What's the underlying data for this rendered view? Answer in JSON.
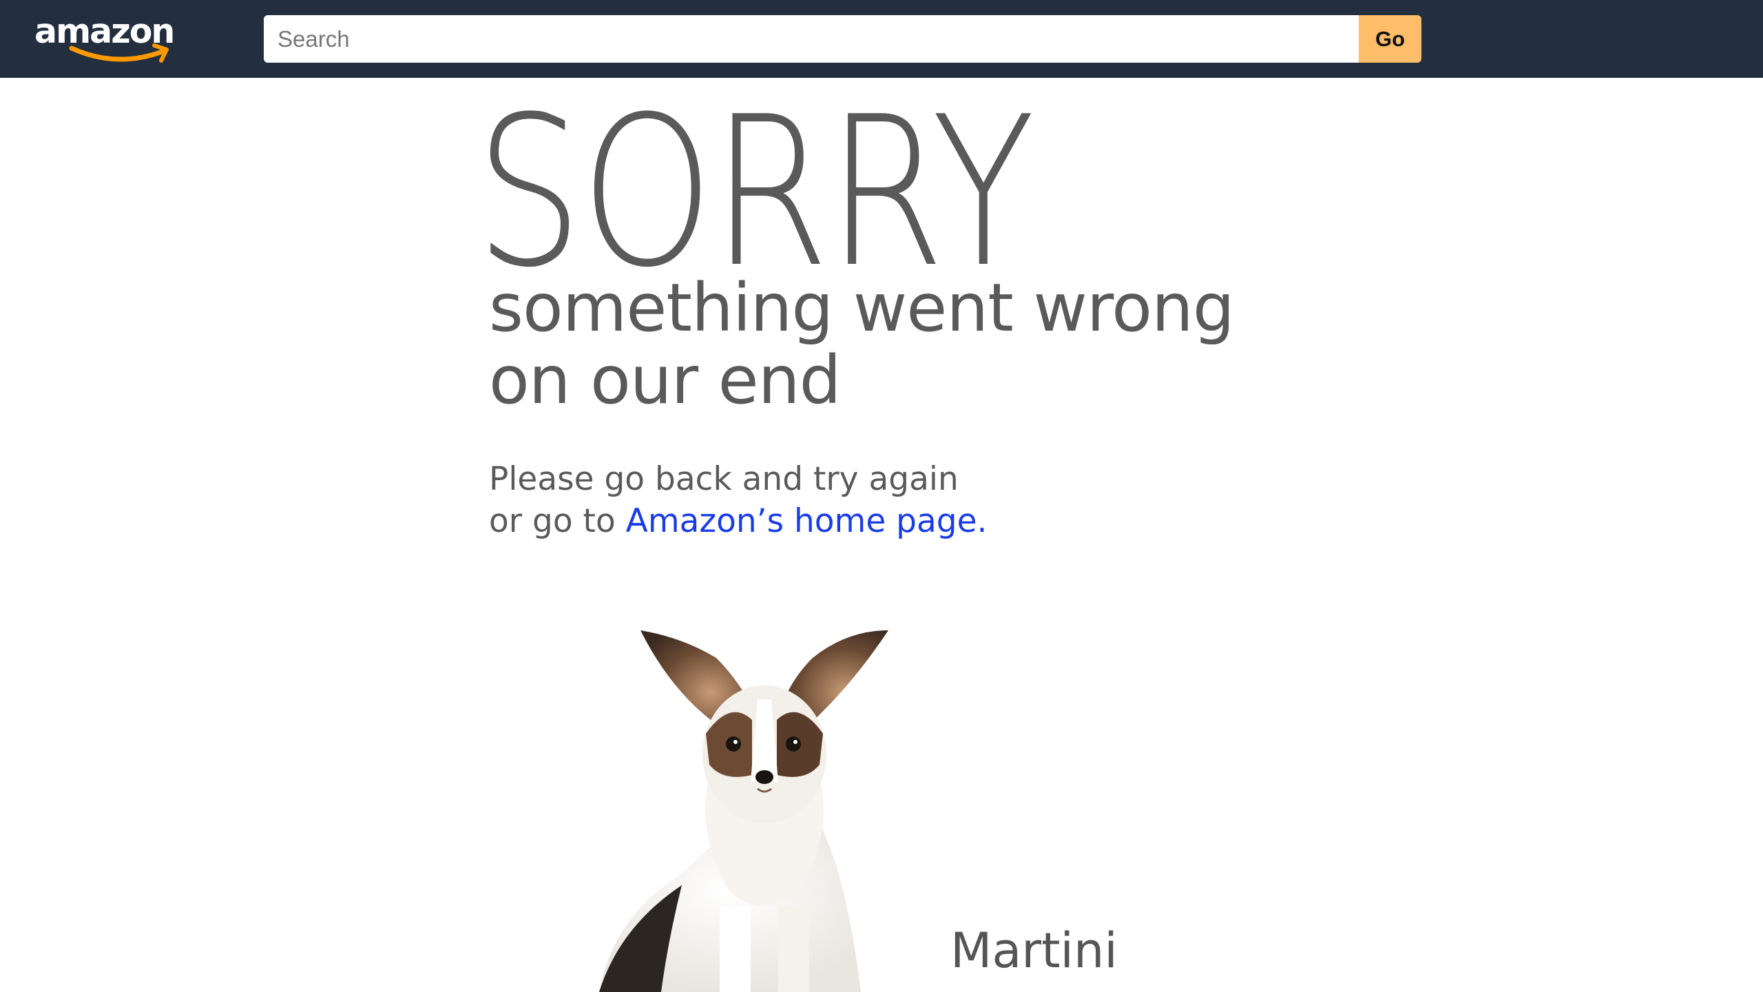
{
  "header": {
    "logo_text": "amazon",
    "search": {
      "placeholder": "Search",
      "value": ""
    },
    "go_label": "Go"
  },
  "error": {
    "title": "SORRY",
    "headline_line1": "something went wrong",
    "headline_line2": "on our end",
    "message_line1": "Please go back and try again",
    "message_line2_prefix": "or go to ",
    "home_link": "Amazon’s home page."
  },
  "dog": {
    "name": "Martini"
  },
  "colors": {
    "header_bg": "#232f3e",
    "go_button": "#febd69",
    "link": "#1a3ce6",
    "text": "#5a5a5a",
    "smile": "#ff9900"
  }
}
